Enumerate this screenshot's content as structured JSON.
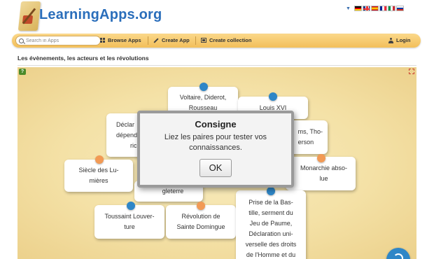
{
  "header": {
    "logo_text": "LearningApps.org",
    "languages": [
      "de",
      "gb",
      "es",
      "fr",
      "it",
      "ru"
    ]
  },
  "nav": {
    "search_placeholder": "Search in Apps",
    "browse_label": "Browse Apps",
    "create_label": "Create App",
    "collection_label": "Create collection",
    "login_label": "Login"
  },
  "page_title": "Les évènements, les acteurs et les révolutions",
  "app": {
    "help_icon_text": "?",
    "cards": [
      {
        "text": "Voltaire, Diderot, Rousseau",
        "dot": "blue"
      },
      {
        "text": "Louis XVI",
        "dot": "blue"
      },
      {
        "text": "Déclaration d'indépendance américaine",
        "dot": "none"
      },
      {
        "text": "Adams, Thomas Jefferson",
        "dot": "none"
      },
      {
        "text": "Siècle des Lumières",
        "dot": "orange"
      },
      {
        "text": "Angleterre",
        "dot": "none"
      },
      {
        "text": "Monarchie absolue",
        "dot": "orange"
      },
      {
        "text": "Toussaint Louverture",
        "dot": "blue"
      },
      {
        "text": "Révolution de Sainte Domingue",
        "dot": "orange"
      },
      {
        "text": "Prise de la Bastille, serment du Jeu de Paume, Déclaration universelle des droits de l'Homme et du Citoyen",
        "dot": "blue"
      }
    ],
    "card_fragments": {
      "c0": "Voltaire, Diderot,",
      "c0b": "Rousseau",
      "c1": "Louis XVI",
      "c2a": "Déclar",
      "c2b": "dépend",
      "c2c": "ric",
      "c3a": "ms, Tho-",
      "c3b": "erson",
      "c4a": "Siècle des Lu-",
      "c4b": "mières",
      "c5": "gleterre",
      "c6a": "Monarchie abso-",
      "c6b": "lue",
      "c7a": "Toussaint Louver-",
      "c7b": "ture",
      "c8a": "Révolution de",
      "c8b": "Sainte Domingue",
      "c9a": "Prise de la Bas-",
      "c9b": "tille, serment du",
      "c9c": "Jeu de Paume,",
      "c9d": "Déclaration uni-",
      "c9e": "verselle des droits",
      "c9f": "de l'Homme et du"
    }
  },
  "modal": {
    "title": "Consigne",
    "text": "Liez les paires pour tester vos connaissances.",
    "button": "OK"
  },
  "colors": {
    "navbar": "#f2bf5a",
    "logo_text": "#2a6ebb",
    "dot_blue": "#2e86c7",
    "dot_orange": "#f29a55",
    "app_background": "#f4e1a6"
  }
}
